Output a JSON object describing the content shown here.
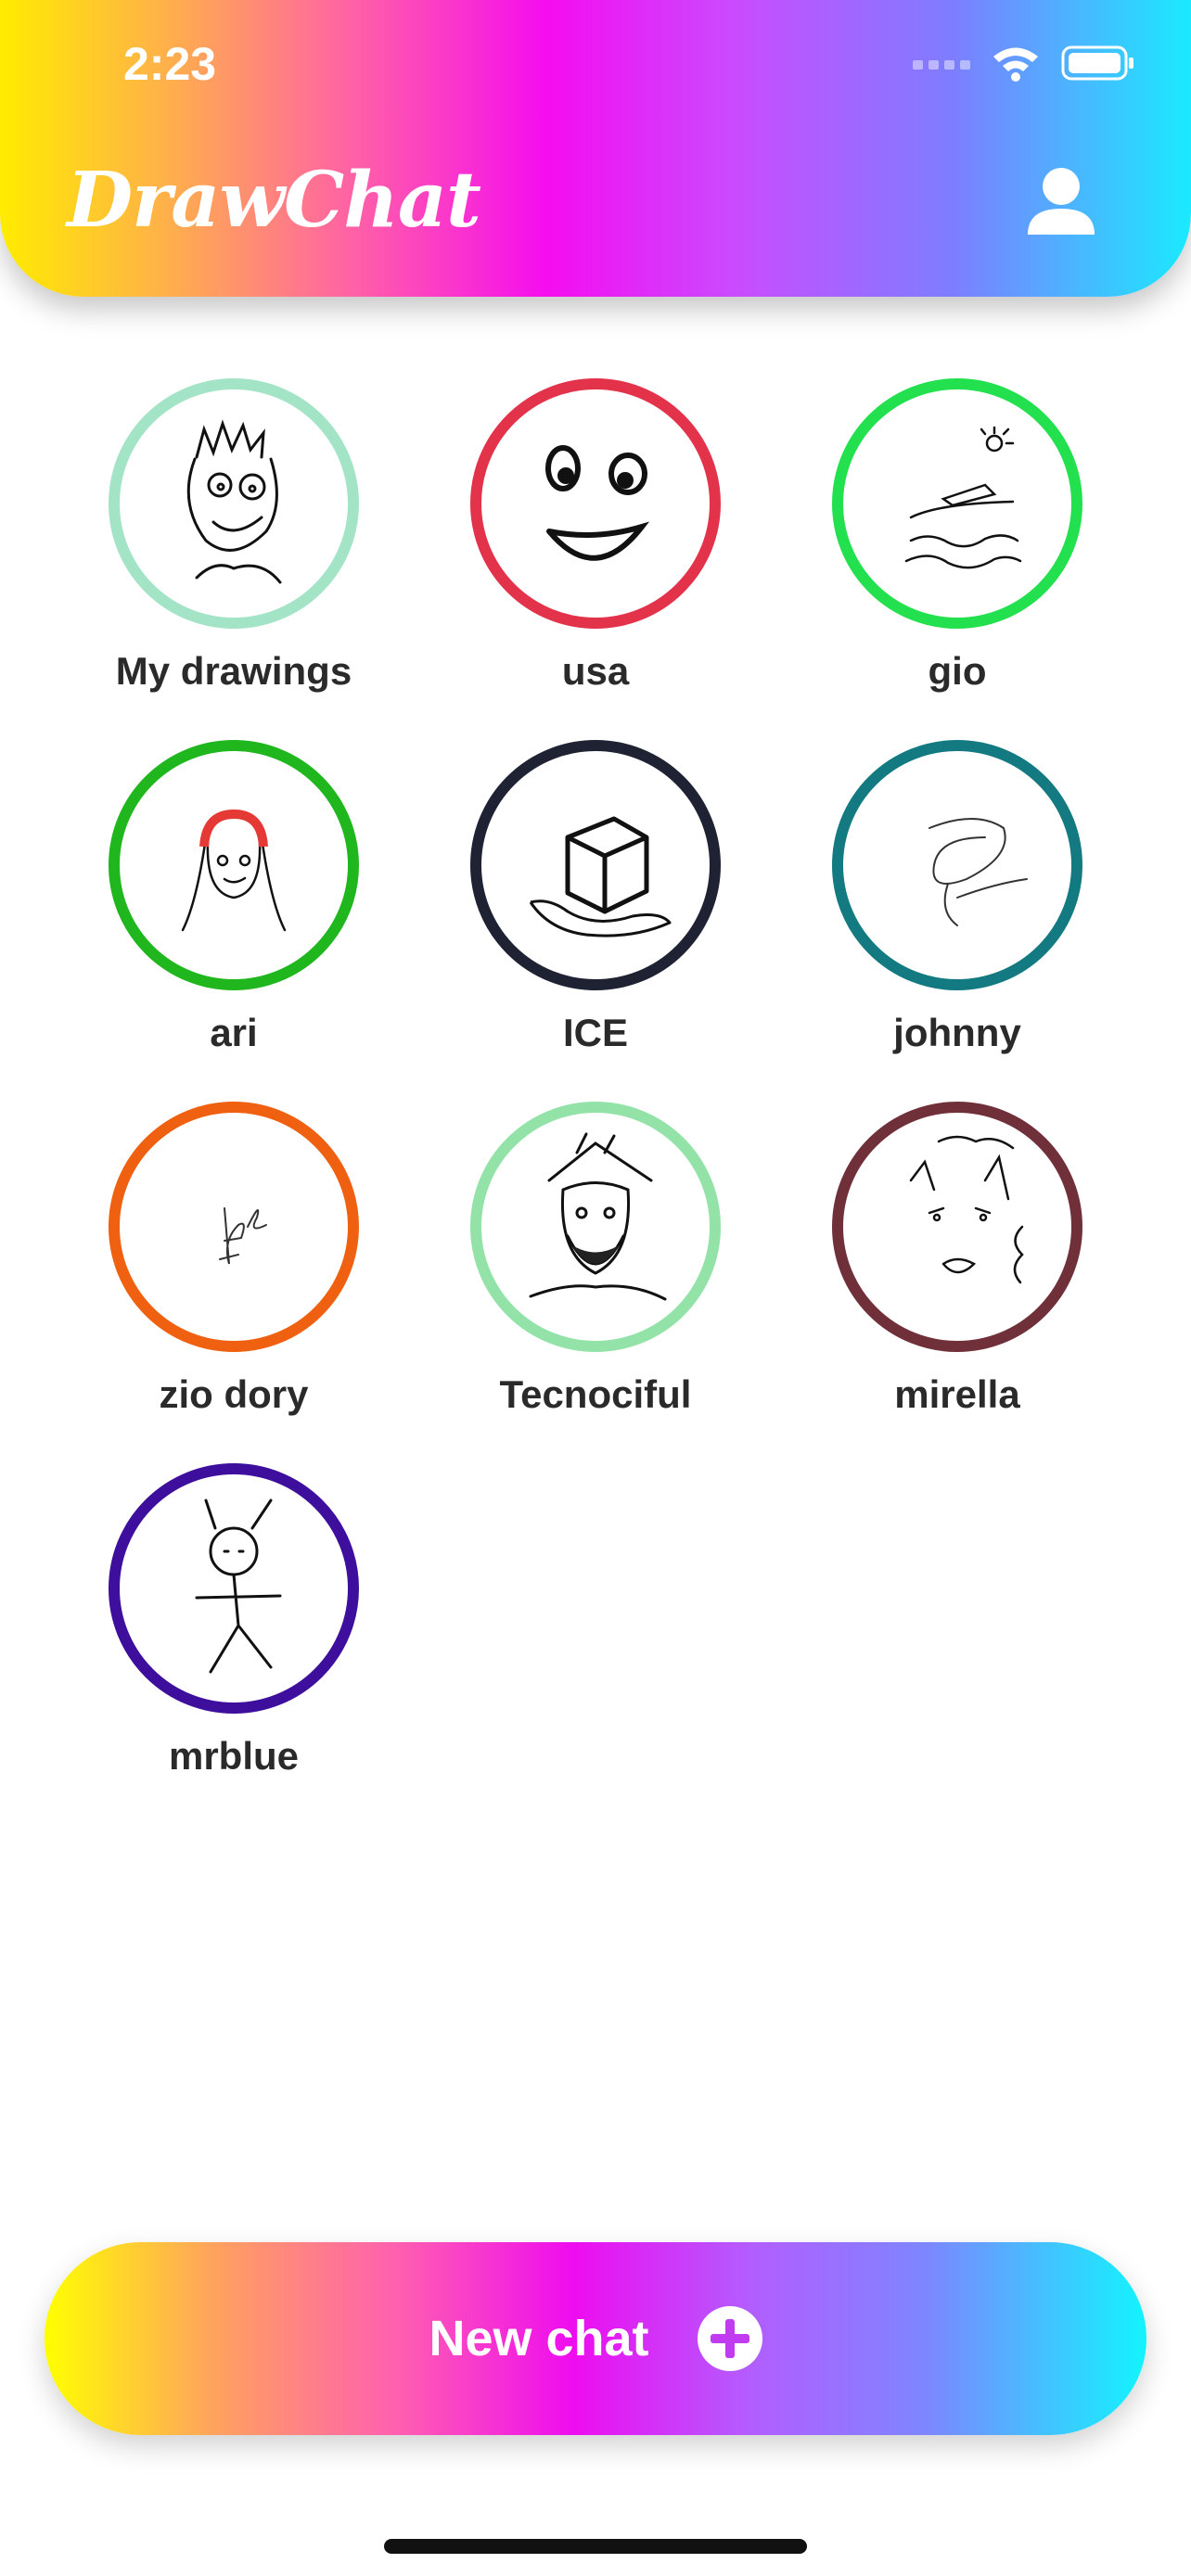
{
  "status_bar": {
    "time": "2:23"
  },
  "header": {
    "title": "DrawChat"
  },
  "contacts": [
    {
      "name": "My drawings",
      "ring_color": "#a3e4c6"
    },
    {
      "name": "usa",
      "ring_color": "#e3334b"
    },
    {
      "name": "gio",
      "ring_color": "#22e04e"
    },
    {
      "name": "ari",
      "ring_color": "#20b61e"
    },
    {
      "name": "ICE",
      "ring_color": "#1e2233"
    },
    {
      "name": "johnny",
      "ring_color": "#127a80"
    },
    {
      "name": "zio dory",
      "ring_color": "#ef6010"
    },
    {
      "name": "Tecnociful",
      "ring_color": "#93e3a8"
    },
    {
      "name": "mirella",
      "ring_color": "#70303a"
    },
    {
      "name": "mrblue",
      "ring_color": "#3e0e9c"
    }
  ],
  "new_chat": {
    "label": "New chat"
  },
  "icons": {
    "profile": "person-icon",
    "add": "plus-circle-icon",
    "wifi": "wifi-icon",
    "battery": "battery-icon",
    "signal": "signal-icon"
  }
}
